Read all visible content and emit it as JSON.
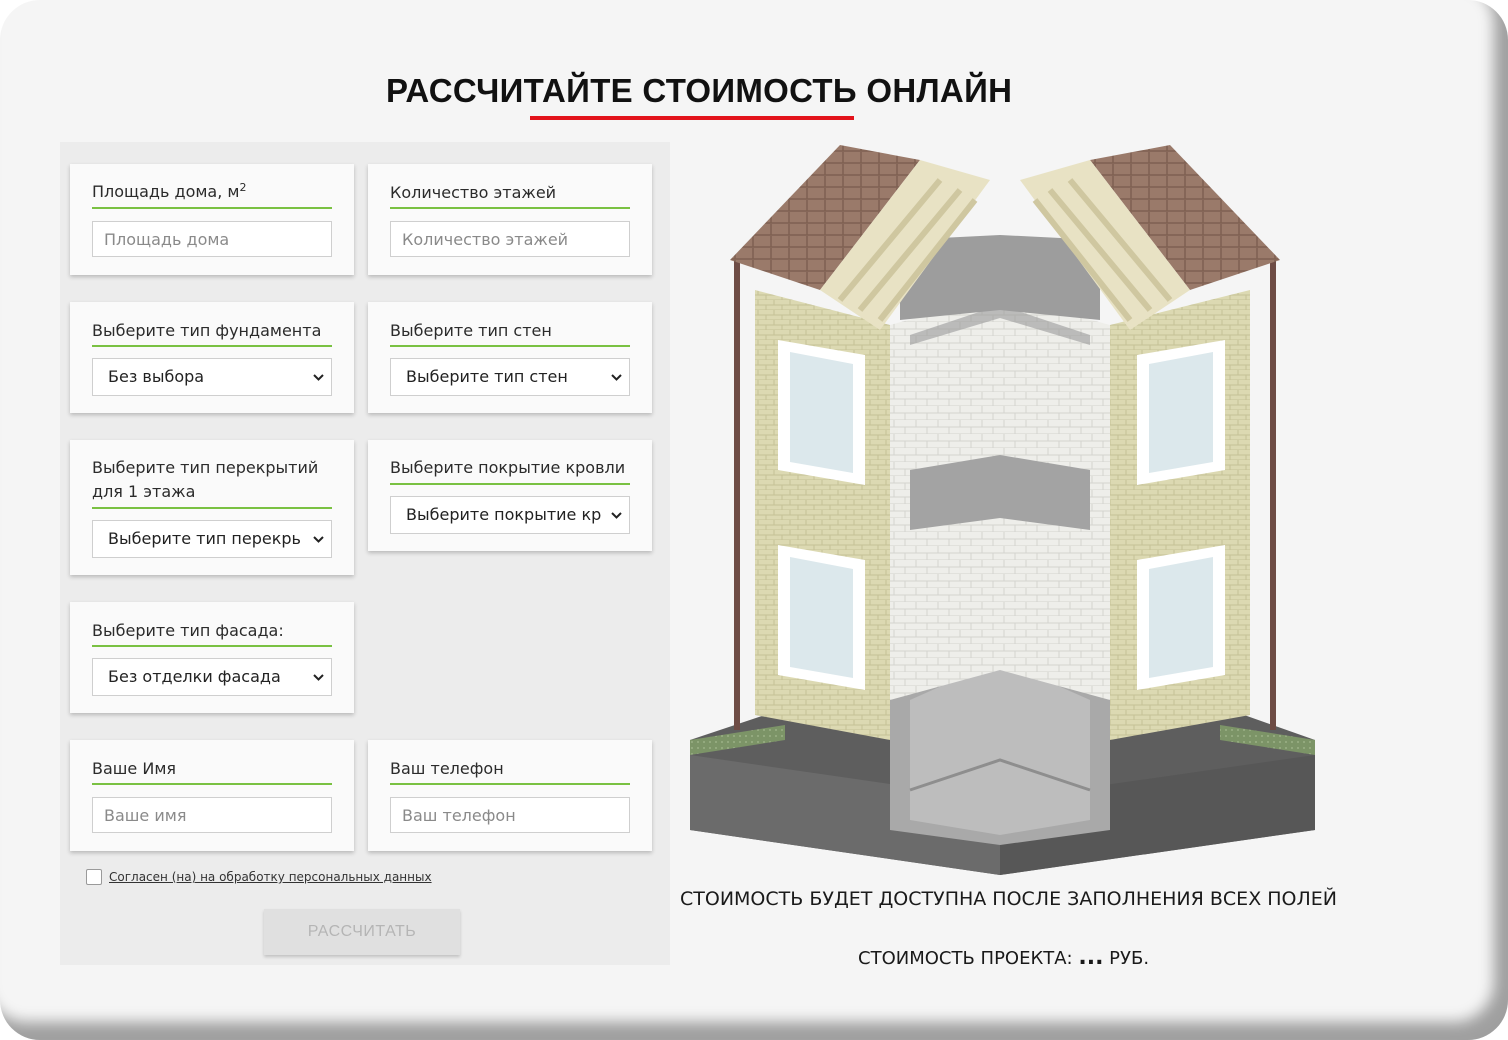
{
  "header": {
    "title": "РАССЧИТАЙТЕ СТОИМОСТЬ ОНЛАЙН"
  },
  "form": {
    "area": {
      "label": "Площадь дома, м",
      "label_sup": "2",
      "placeholder": "Площадь дома"
    },
    "floors": {
      "label": "Количество этажей",
      "placeholder": "Количество этажей"
    },
    "foundation": {
      "label": "Выберите тип фундамента",
      "selected": "Без выбора"
    },
    "walls": {
      "label": "Выберите тип стен",
      "selected": "Выберите тип стен"
    },
    "slabs": {
      "label_line1": "Выберите тип перекрытий",
      "label_line2": "для 1 этажа",
      "selected": "Выберите тип перекрь"
    },
    "roof": {
      "label": "Выберите покрытие кровли",
      "selected": "Выберите покрытие кр"
    },
    "facade": {
      "label": "Выберите тип фасада:",
      "selected": "Без отделки фасада"
    },
    "name": {
      "label": "Ваше Имя",
      "placeholder": "Ваше имя"
    },
    "phone": {
      "label": "Ваш телефон",
      "placeholder": "Ваш телефон"
    },
    "consent_text": "Согласен (на) на обработку персональных данных",
    "consent_checked": false,
    "submit_label": "РАССЧИТАТЬ"
  },
  "result": {
    "status": "СТОИМОСТЬ БУДЕТ ДОСТУПНА ПОСЛЕ ЗАПОЛНЕНИЯ ВСЕХ ПОЛЕЙ",
    "price_prefix": "СТОИМОСТЬ ПРОЕКТА:",
    "price_value": "...",
    "price_unit": "РУБ."
  },
  "colors": {
    "accent_red": "#e3131b",
    "accent_green": "#7ac142"
  },
  "icons": {
    "dropdown": "chevron-down-icon",
    "illustration": "house-cutaway-illustration"
  }
}
